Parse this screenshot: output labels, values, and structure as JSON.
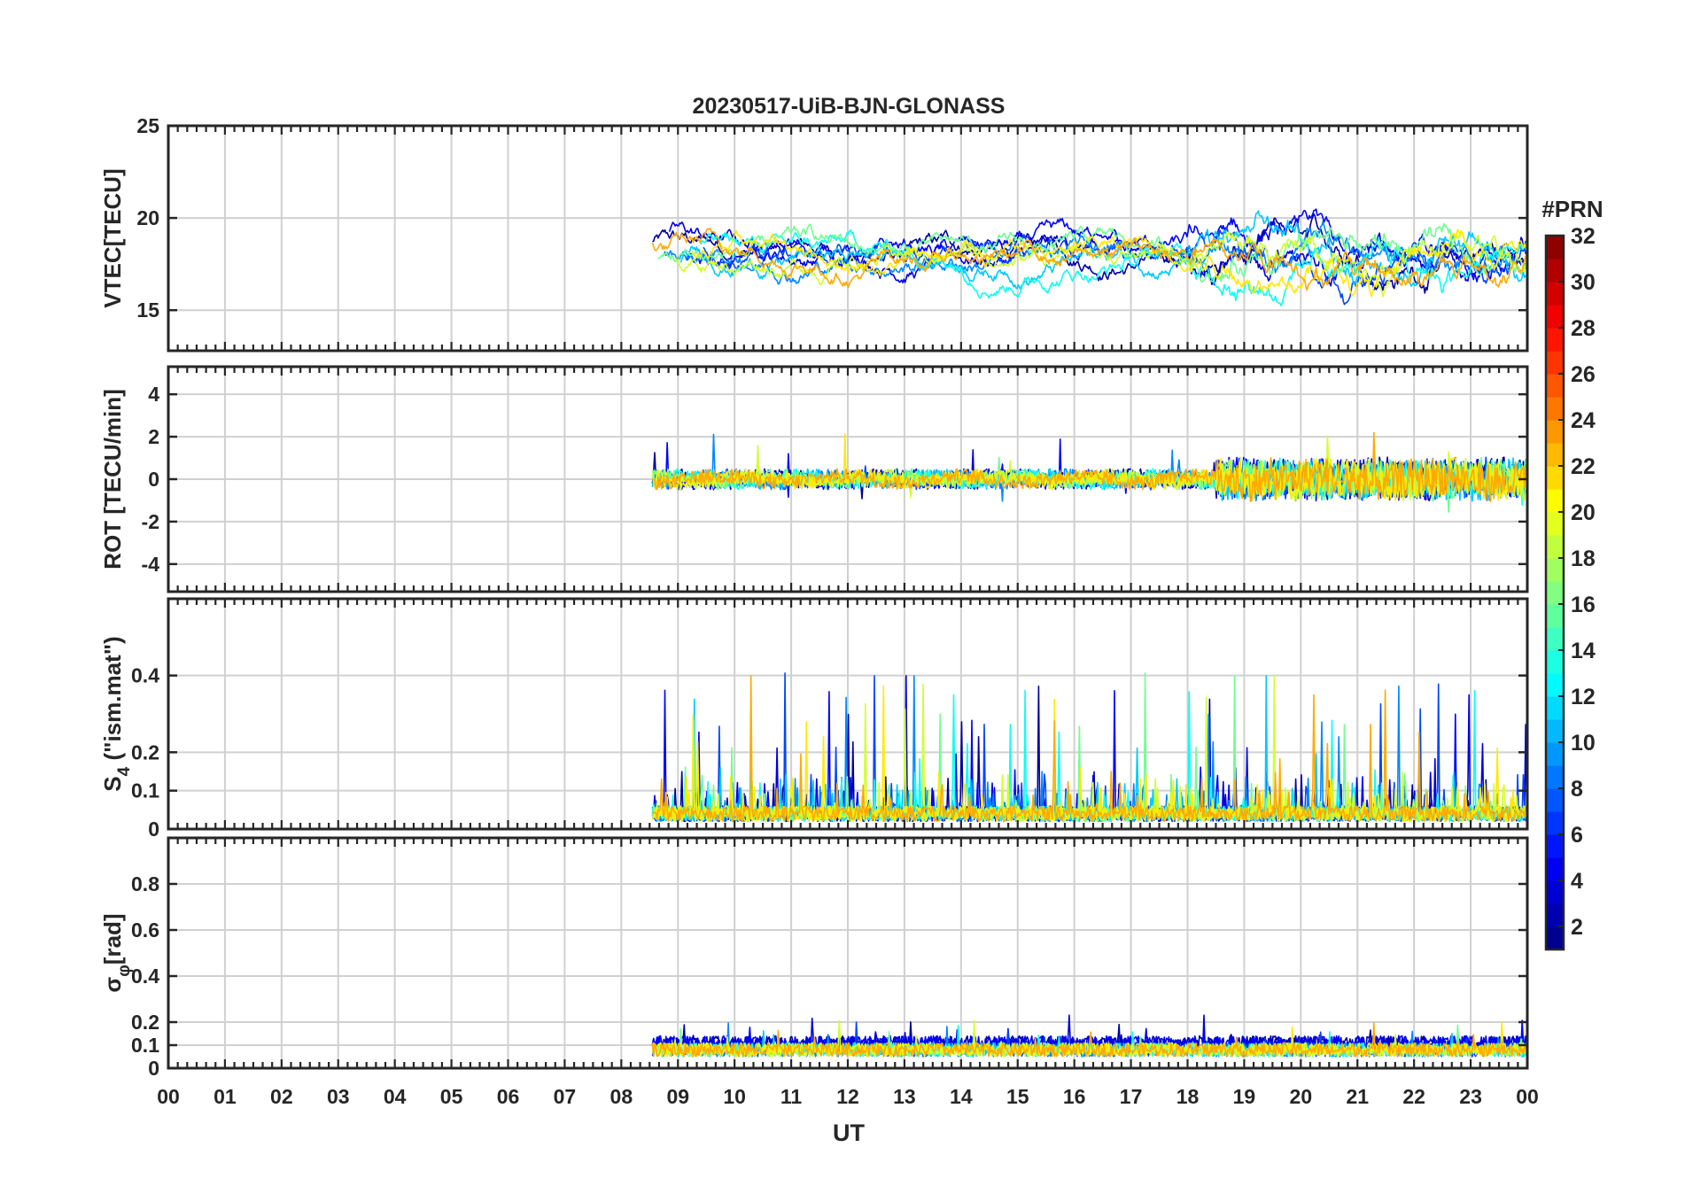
{
  "chart_data": {
    "type": "line",
    "title": "20230517-UiB-BJN-GLONASS",
    "xlabel": "UT",
    "x_ticks": [
      "00",
      "01",
      "02",
      "03",
      "04",
      "05",
      "06",
      "07",
      "08",
      "09",
      "10",
      "11",
      "12",
      "13",
      "14",
      "15",
      "16",
      "17",
      "18",
      "19",
      "20",
      "21",
      "22",
      "23",
      "00"
    ],
    "xlim_hours": [
      0,
      24
    ],
    "data_start_hour": 8.55,
    "grid": true,
    "panels": [
      {
        "id": "vtec",
        "ylabel": "VTEC[TECU]",
        "ylim": [
          12.8,
          25
        ],
        "yticks": [
          15,
          20,
          25
        ],
        "ytick_labels": [
          "15",
          "20",
          "25"
        ],
        "typical_range": [
          14,
          21.5
        ]
      },
      {
        "id": "rot",
        "ylabel": "ROT [TECU/min]",
        "ylim": [
          -5.3,
          5.3
        ],
        "yticks": [
          -4,
          -2,
          0,
          2,
          4
        ],
        "ytick_labels": [
          "-4",
          "-2",
          "0",
          "2",
          "4"
        ],
        "typical_range": [
          -2.2,
          2.9
        ]
      },
      {
        "id": "s4",
        "ylabel_main": "S",
        "ylabel_sub": "4",
        "ylabel_rest": " (\"ism.mat\")",
        "ylim": [
          0,
          0.6
        ],
        "yticks": [
          0,
          0.1,
          0.2,
          0.4
        ],
        "ytick_labels": [
          "0",
          "0.1",
          "0.2",
          "0.4"
        ],
        "typical_range": [
          0,
          0.44
        ]
      },
      {
        "id": "sigma",
        "ylabel_main": "σ",
        "ylabel_sub": "φ",
        "ylabel_rest": "[rad]",
        "ylim": [
          0,
          1
        ],
        "yticks": [
          0,
          0.1,
          0.2,
          0.4,
          0.6,
          0.8
        ],
        "ytick_labels": [
          "0",
          "0.1",
          "0.2",
          "0.4",
          "0.6",
          "0.8"
        ],
        "typical_range": [
          0,
          0.23
        ]
      }
    ],
    "colorbar": {
      "label": "#PRN",
      "range": [
        1,
        32
      ],
      "ticks": [
        2,
        4,
        6,
        8,
        10,
        12,
        14,
        16,
        18,
        20,
        22,
        24,
        26,
        28,
        30,
        32
      ],
      "tick_labels": [
        "2",
        "4",
        "6",
        "8",
        "10",
        "12",
        "14",
        "16",
        "18",
        "20",
        "22",
        "24",
        "26",
        "28",
        "30",
        "32"
      ],
      "colormap": "jet"
    },
    "series_prns": [
      2,
      4,
      5,
      7,
      9,
      11,
      13,
      16,
      19,
      21,
      23
    ],
    "axis_color": "#262626",
    "grid_color": "#d0d0d0"
  }
}
